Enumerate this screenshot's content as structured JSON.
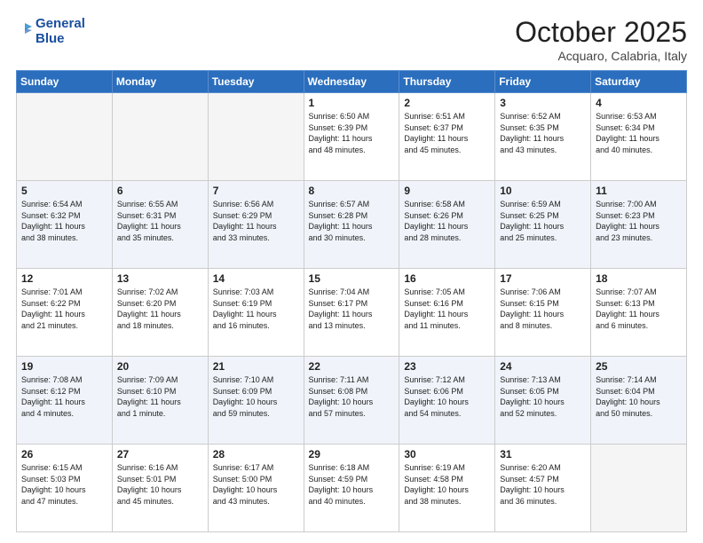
{
  "header": {
    "logo": {
      "line1": "General",
      "line2": "Blue"
    },
    "title": "October 2025",
    "subtitle": "Acquaro, Calabria, Italy"
  },
  "weekdays": [
    "Sunday",
    "Monday",
    "Tuesday",
    "Wednesday",
    "Thursday",
    "Friday",
    "Saturday"
  ],
  "weeks": [
    [
      {
        "day": "",
        "info": ""
      },
      {
        "day": "",
        "info": ""
      },
      {
        "day": "",
        "info": ""
      },
      {
        "day": "1",
        "info": "Sunrise: 6:50 AM\nSunset: 6:39 PM\nDaylight: 11 hours\nand 48 minutes."
      },
      {
        "day": "2",
        "info": "Sunrise: 6:51 AM\nSunset: 6:37 PM\nDaylight: 11 hours\nand 45 minutes."
      },
      {
        "day": "3",
        "info": "Sunrise: 6:52 AM\nSunset: 6:35 PM\nDaylight: 11 hours\nand 43 minutes."
      },
      {
        "day": "4",
        "info": "Sunrise: 6:53 AM\nSunset: 6:34 PM\nDaylight: 11 hours\nand 40 minutes."
      }
    ],
    [
      {
        "day": "5",
        "info": "Sunrise: 6:54 AM\nSunset: 6:32 PM\nDaylight: 11 hours\nand 38 minutes."
      },
      {
        "day": "6",
        "info": "Sunrise: 6:55 AM\nSunset: 6:31 PM\nDaylight: 11 hours\nand 35 minutes."
      },
      {
        "day": "7",
        "info": "Sunrise: 6:56 AM\nSunset: 6:29 PM\nDaylight: 11 hours\nand 33 minutes."
      },
      {
        "day": "8",
        "info": "Sunrise: 6:57 AM\nSunset: 6:28 PM\nDaylight: 11 hours\nand 30 minutes."
      },
      {
        "day": "9",
        "info": "Sunrise: 6:58 AM\nSunset: 6:26 PM\nDaylight: 11 hours\nand 28 minutes."
      },
      {
        "day": "10",
        "info": "Sunrise: 6:59 AM\nSunset: 6:25 PM\nDaylight: 11 hours\nand 25 minutes."
      },
      {
        "day": "11",
        "info": "Sunrise: 7:00 AM\nSunset: 6:23 PM\nDaylight: 11 hours\nand 23 minutes."
      }
    ],
    [
      {
        "day": "12",
        "info": "Sunrise: 7:01 AM\nSunset: 6:22 PM\nDaylight: 11 hours\nand 21 minutes."
      },
      {
        "day": "13",
        "info": "Sunrise: 7:02 AM\nSunset: 6:20 PM\nDaylight: 11 hours\nand 18 minutes."
      },
      {
        "day": "14",
        "info": "Sunrise: 7:03 AM\nSunset: 6:19 PM\nDaylight: 11 hours\nand 16 minutes."
      },
      {
        "day": "15",
        "info": "Sunrise: 7:04 AM\nSunset: 6:17 PM\nDaylight: 11 hours\nand 13 minutes."
      },
      {
        "day": "16",
        "info": "Sunrise: 7:05 AM\nSunset: 6:16 PM\nDaylight: 11 hours\nand 11 minutes."
      },
      {
        "day": "17",
        "info": "Sunrise: 7:06 AM\nSunset: 6:15 PM\nDaylight: 11 hours\nand 8 minutes."
      },
      {
        "day": "18",
        "info": "Sunrise: 7:07 AM\nSunset: 6:13 PM\nDaylight: 11 hours\nand 6 minutes."
      }
    ],
    [
      {
        "day": "19",
        "info": "Sunrise: 7:08 AM\nSunset: 6:12 PM\nDaylight: 11 hours\nand 4 minutes."
      },
      {
        "day": "20",
        "info": "Sunrise: 7:09 AM\nSunset: 6:10 PM\nDaylight: 11 hours\nand 1 minute."
      },
      {
        "day": "21",
        "info": "Sunrise: 7:10 AM\nSunset: 6:09 PM\nDaylight: 10 hours\nand 59 minutes."
      },
      {
        "day": "22",
        "info": "Sunrise: 7:11 AM\nSunset: 6:08 PM\nDaylight: 10 hours\nand 57 minutes."
      },
      {
        "day": "23",
        "info": "Sunrise: 7:12 AM\nSunset: 6:06 PM\nDaylight: 10 hours\nand 54 minutes."
      },
      {
        "day": "24",
        "info": "Sunrise: 7:13 AM\nSunset: 6:05 PM\nDaylight: 10 hours\nand 52 minutes."
      },
      {
        "day": "25",
        "info": "Sunrise: 7:14 AM\nSunset: 6:04 PM\nDaylight: 10 hours\nand 50 minutes."
      }
    ],
    [
      {
        "day": "26",
        "info": "Sunrise: 6:15 AM\nSunset: 5:03 PM\nDaylight: 10 hours\nand 47 minutes."
      },
      {
        "day": "27",
        "info": "Sunrise: 6:16 AM\nSunset: 5:01 PM\nDaylight: 10 hours\nand 45 minutes."
      },
      {
        "day": "28",
        "info": "Sunrise: 6:17 AM\nSunset: 5:00 PM\nDaylight: 10 hours\nand 43 minutes."
      },
      {
        "day": "29",
        "info": "Sunrise: 6:18 AM\nSunset: 4:59 PM\nDaylight: 10 hours\nand 40 minutes."
      },
      {
        "day": "30",
        "info": "Sunrise: 6:19 AM\nSunset: 4:58 PM\nDaylight: 10 hours\nand 38 minutes."
      },
      {
        "day": "31",
        "info": "Sunrise: 6:20 AM\nSunset: 4:57 PM\nDaylight: 10 hours\nand 36 minutes."
      },
      {
        "day": "",
        "info": ""
      }
    ]
  ]
}
